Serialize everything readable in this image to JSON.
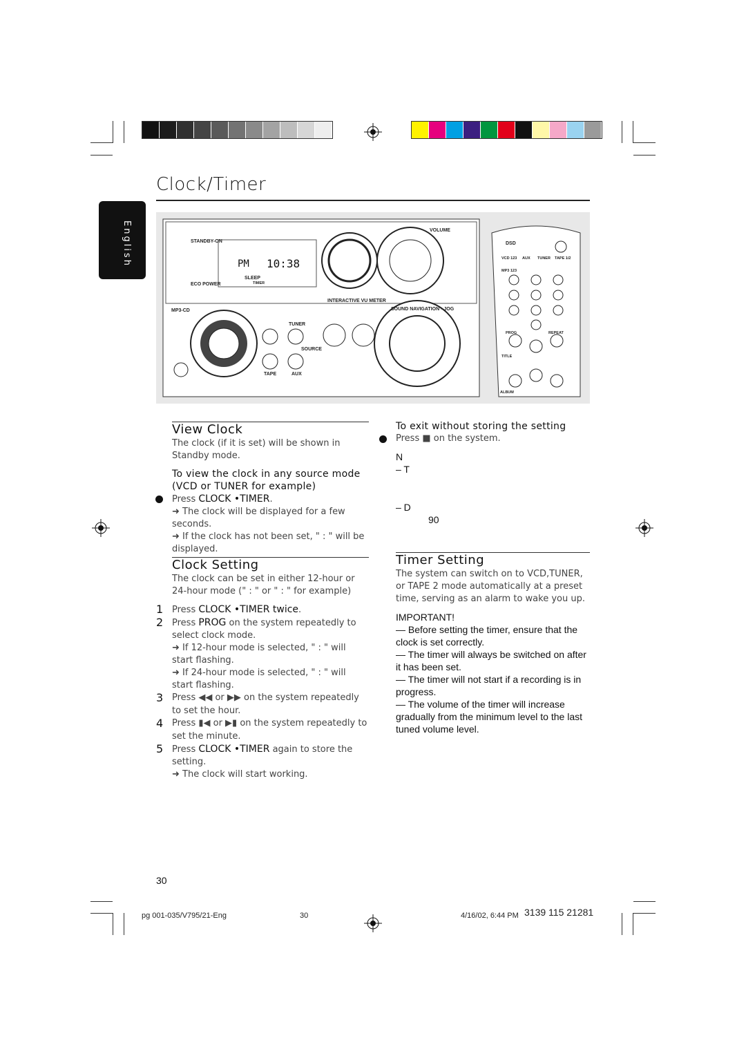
{
  "colors": {
    "grays": [
      "#111111",
      "#1c1c1c",
      "#303030",
      "#454545",
      "#5a5a5a",
      "#737373",
      "#8a8a8a",
      "#a3a3a3",
      "#bdbdbd",
      "#d6d6d6",
      "#eeeeee"
    ],
    "swatches": [
      "#fff200",
      "#e6007e",
      "#00a0e3",
      "#3b1f80",
      "#00963f",
      "#e2001a",
      "#111111",
      "#fff7a8",
      "#f5a8c8",
      "#9ad3f0",
      "#9a9a9a"
    ]
  },
  "page_title": "Clock/Timer",
  "language_tab": "English",
  "figure": {
    "display_left": "PM",
    "display_time": "10:38",
    "labels": [
      "STANDBY-ON",
      "ECO POWER",
      "VOLUME",
      "INTERACTIVE VU METER",
      "SOUND NAVIGATION - JOG",
      "MP3-CD",
      "TUNER",
      "TAPE",
      "AUX",
      "SOURCE",
      "VCD 123",
      "AUX",
      "TUNER",
      "TAPE 1/2",
      "MP3 123",
      "DSD",
      "PROG",
      "REPEAT",
      "TITLE",
      "ALBUM",
      "SLEEP",
      "TIMER"
    ]
  },
  "view_clock": {
    "heading": "View Clock",
    "intro": "The clock (if it is set) will be shown in Standby mode.",
    "subheading": "To view the clock in any source mode (VCD or TUNER for example)",
    "press": "Press ",
    "key": "CLOCK •TIMER",
    "after": ".",
    "result1": "➜ The clock will be displayed for a few seconds.",
    "result2": "➜ If the clock has not been set, \"     :     \" will be displayed."
  },
  "clock_setting": {
    "heading": "Clock Setting",
    "intro": "The clock can be set in either 12-hour or 24-hour mode (\"          :     \" or \"     :     \" for example)",
    "steps": [
      {
        "n": "1",
        "pre": "Press ",
        "key": "CLOCK •TIMER twice",
        "post": ".",
        "notes": []
      },
      {
        "n": "2",
        "pre": "Press ",
        "key": "PROG",
        "post": "  on the system repeatedly to select clock mode.",
        "notes": [
          "➜ If 12-hour mode is selected, \"          :     \" will start flashing.",
          "➜ If 24-hour mode is selected, \"     :     \" will start flashing."
        ]
      },
      {
        "n": "3",
        "pre": "Press ◀◀ or ▶▶ on the system repeatedly to set the hour.",
        "key": "",
        "post": "",
        "notes": []
      },
      {
        "n": "4",
        "pre": "Press ▮◀ or ▶▮ on the system repeatedly to set the minute.",
        "key": "",
        "post": "",
        "notes": []
      },
      {
        "n": "5",
        "pre": "Press ",
        "key": "CLOCK •TIMER",
        "post": " again to store the setting.",
        "notes": [
          "➜ The clock will start working."
        ]
      }
    ]
  },
  "exit": {
    "heading": "To exit without storing the setting",
    "text": "Press ■ on the system."
  },
  "notes": {
    "n": "N",
    "t": "– T",
    "d": "– D",
    "ninety": "90"
  },
  "timer_setting": {
    "heading": "Timer Setting",
    "intro": "The system can switch on to VCD,TUNER, or TAPE 2 mode automatically at a preset time, serving as an alarm to wake you up.",
    "important": "IMPORTANT!",
    "items": [
      "— Before setting the timer, ensure that the clock is set correctly.",
      "— The timer will always be switched on after it has been set.",
      "— The timer will not start if a recording is in progress.",
      "— The volume of the timer will increase gradually from the minimum level to the last tuned volume level."
    ]
  },
  "page_number": "30",
  "footer": {
    "file": "pg 001-035/V795/21-Eng",
    "page": "30",
    "date": "4/16/02, 6:44 PM",
    "code": "3139 115 21281"
  }
}
